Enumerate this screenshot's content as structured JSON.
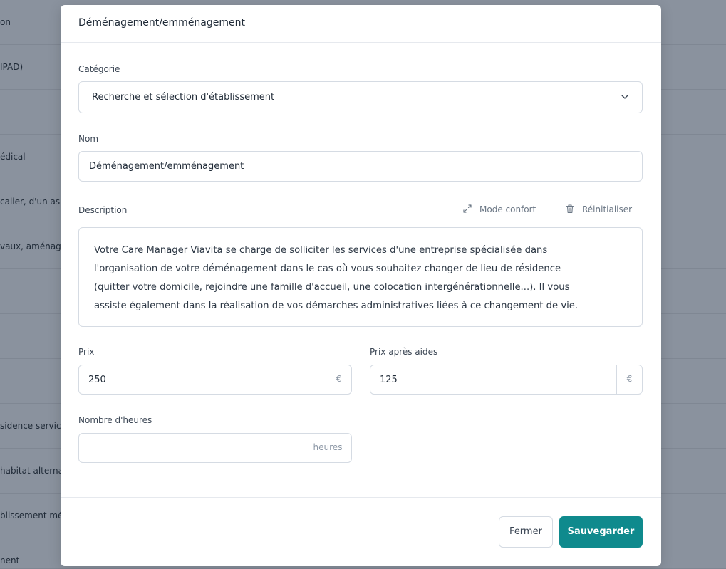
{
  "background": {
    "rows": [
      {
        "label": "on"
      },
      {
        "label": "IPAD)"
      },
      {
        "label": ""
      },
      {
        "label": "édical"
      },
      {
        "label": "calier, d'un as"
      },
      {
        "label": "vaux, aménage"
      },
      {
        "label": ""
      },
      {
        "label": ""
      },
      {
        "label": ""
      },
      {
        "label": "sidence servic"
      },
      {
        "label": "habitat alterna"
      },
      {
        "label": "blissement mé"
      },
      {
        "label": "nent"
      }
    ]
  },
  "modal": {
    "title": "Déménagement/emménagement",
    "category": {
      "label": "Catégorie",
      "value": "Recherche et sélection d'établissement",
      "icon": "chevron-down-icon"
    },
    "name": {
      "label": "Nom",
      "value": "Déménagement/emménagement"
    },
    "description": {
      "label": "Description",
      "comfort_mode_label": "Mode confort",
      "reset_label": "Réinitialiser",
      "lines": [
        "Votre Care Manager Viavita se charge de solliciter les services d'une entreprise spécialisée dans",
        "l'organisation de votre déménagement dans le cas où vous souhaitez changer de lieu de résidence",
        "(quitter votre domicile, rejoindre une famille d'accueil, une colocation intergénérationnelle...). Il vous",
        "assiste également dans la réalisation de vos démarches administratives liées à ce changement de vie."
      ]
    },
    "price": {
      "label": "Prix",
      "value": "250",
      "unit": "€"
    },
    "price_after_aid": {
      "label": "Prix après aides",
      "value": "125",
      "unit": "€"
    },
    "hours": {
      "label": "Nombre d'heures",
      "value": "",
      "unit": "heures"
    },
    "buttons": {
      "close": "Fermer",
      "save": "Sauvegarder"
    }
  },
  "colors": {
    "accent": "#0f8a8d",
    "overlay": "#8a929e"
  }
}
